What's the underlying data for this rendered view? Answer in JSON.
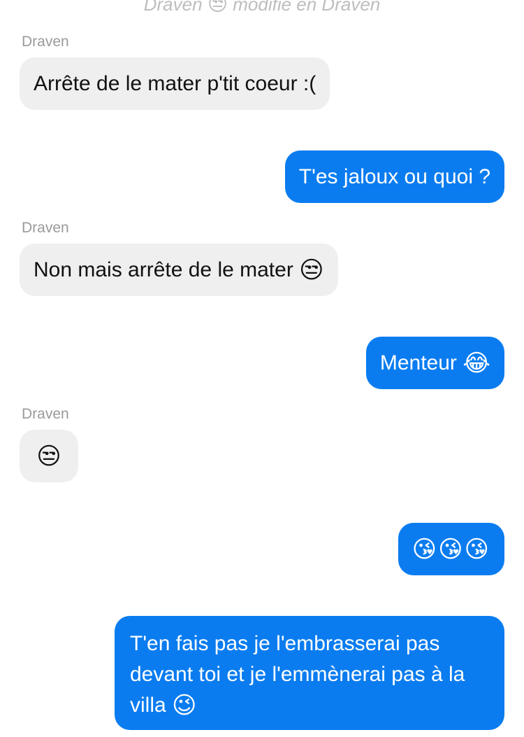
{
  "system_note": {
    "prefix": "Draven",
    "emoji": "😒",
    "suffix": "modifié en Draven"
  },
  "messages": [
    {
      "sender": "Draven",
      "text": "Arrête de le mater p'tit coeur :(",
      "emoji": ""
    },
    {
      "text": "T'es jaloux ou quoi ?",
      "emoji": ""
    },
    {
      "sender": "Draven",
      "text": "Non mais arrête de le mater",
      "emoji": "😒"
    },
    {
      "text": "Menteur",
      "emoji": "😂"
    },
    {
      "sender": "Draven",
      "text": "",
      "emoji": "😒"
    },
    {
      "text": "",
      "emoji": "😘😘😘"
    },
    {
      "text": "T'en fais pas je l'embrasserai pas devant toi et je l'emmènerai pas à la villa",
      "emoji": "😉"
    }
  ]
}
